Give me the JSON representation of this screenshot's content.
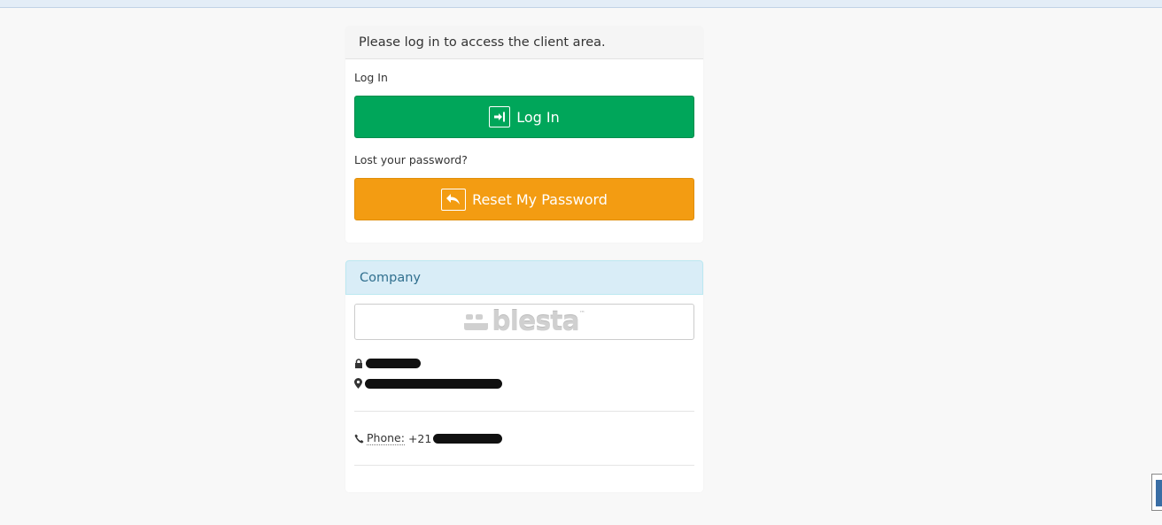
{
  "login": {
    "heading": "Please log in to access the client area.",
    "login_label": "Log In",
    "login_button": "Log In",
    "lost_password_label": "Lost your password?",
    "reset_button": "Reset My Password"
  },
  "company": {
    "heading": "Company",
    "logo_text": "blesta",
    "phone_label": "Phone:",
    "phone_value": "+21"
  },
  "colors": {
    "success": "#00a65a",
    "warning": "#f39c12",
    "info_bg": "#d9edf7",
    "info_text": "#31708f"
  }
}
